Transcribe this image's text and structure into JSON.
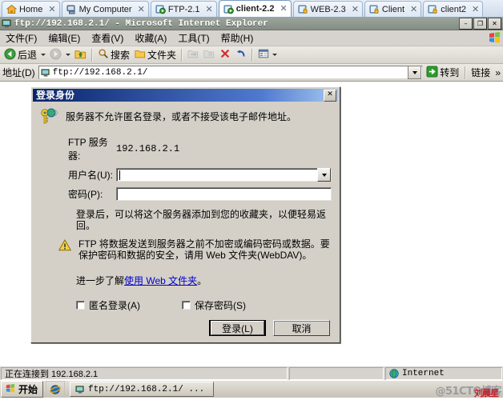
{
  "browser_tabs": [
    {
      "label": "Home",
      "icon": "home-icon",
      "active": false
    },
    {
      "label": "My Computer",
      "icon": "computer-icon",
      "active": false
    },
    {
      "label": "FTP-2.1",
      "icon": "remote-desktop-icon",
      "active": false
    },
    {
      "label": "client-2.2",
      "icon": "remote-desktop-icon",
      "active": true
    },
    {
      "label": "WEB-2.3",
      "icon": "lock-icon",
      "active": false
    },
    {
      "label": "Client",
      "icon": "lock-icon",
      "active": false
    },
    {
      "label": "client2",
      "icon": "lock-icon",
      "active": false
    }
  ],
  "tab_close_glyph": "✕",
  "window": {
    "title": "ftp://192.168.2.1/ - Microsoft Internet Explorer",
    "minimize": "–",
    "restore": "❐",
    "close": "✕"
  },
  "menu": {
    "items": [
      "文件(F)",
      "编辑(E)",
      "查看(V)",
      "收藏(A)",
      "工具(T)",
      "帮助(H)"
    ]
  },
  "toolbar": {
    "back": "后退",
    "search": "搜索",
    "folders": "文件夹"
  },
  "address": {
    "label": "地址(D)",
    "url": "ftp://192.168.2.1/",
    "go": "转到",
    "links": "链接",
    "links_chevron": "»"
  },
  "dialog": {
    "title": "登录身份",
    "close_glyph": "✕",
    "message": "服务器不允许匿名登录，或者不接受该电子邮件地址。",
    "server_label": "FTP 服务器:",
    "server_value": "192.168.2.1",
    "username_label": "用户名(U):",
    "username_value": "",
    "password_label": "密码(P):",
    "password_value": "",
    "note": "登录后，可以将这个服务器添加到您的收藏夹，以便轻易返回。",
    "warning": "FTP 将数据发送到服务器之前不加密或编码密码或数据。要保护密码和数据的安全，请用 Web 文件夹(WebDAV)。",
    "learn_prefix": "进一步了解",
    "learn_link": "使用 Web 文件夹",
    "learn_suffix": "。",
    "anonymous_label": "匿名登录(A)",
    "savepw_label": "保存密码(S)",
    "login_button": "登录(L)",
    "cancel_button": "取消"
  },
  "statusbar": {
    "left": "正在连接到 192.168.2.1",
    "middle": "",
    "zone": "Internet"
  },
  "taskbar": {
    "start": "开始",
    "task": "ftp://192.168.2.1/ ...",
    "watermark_top": "@51CTO博客",
    "watermark_bottom": "刘晨星"
  },
  "colors": {
    "dialog_face": "#d4d0c8",
    "title_blue": "#0a246a",
    "link": "#0000cc",
    "accent_green": "#2e9a2e"
  }
}
